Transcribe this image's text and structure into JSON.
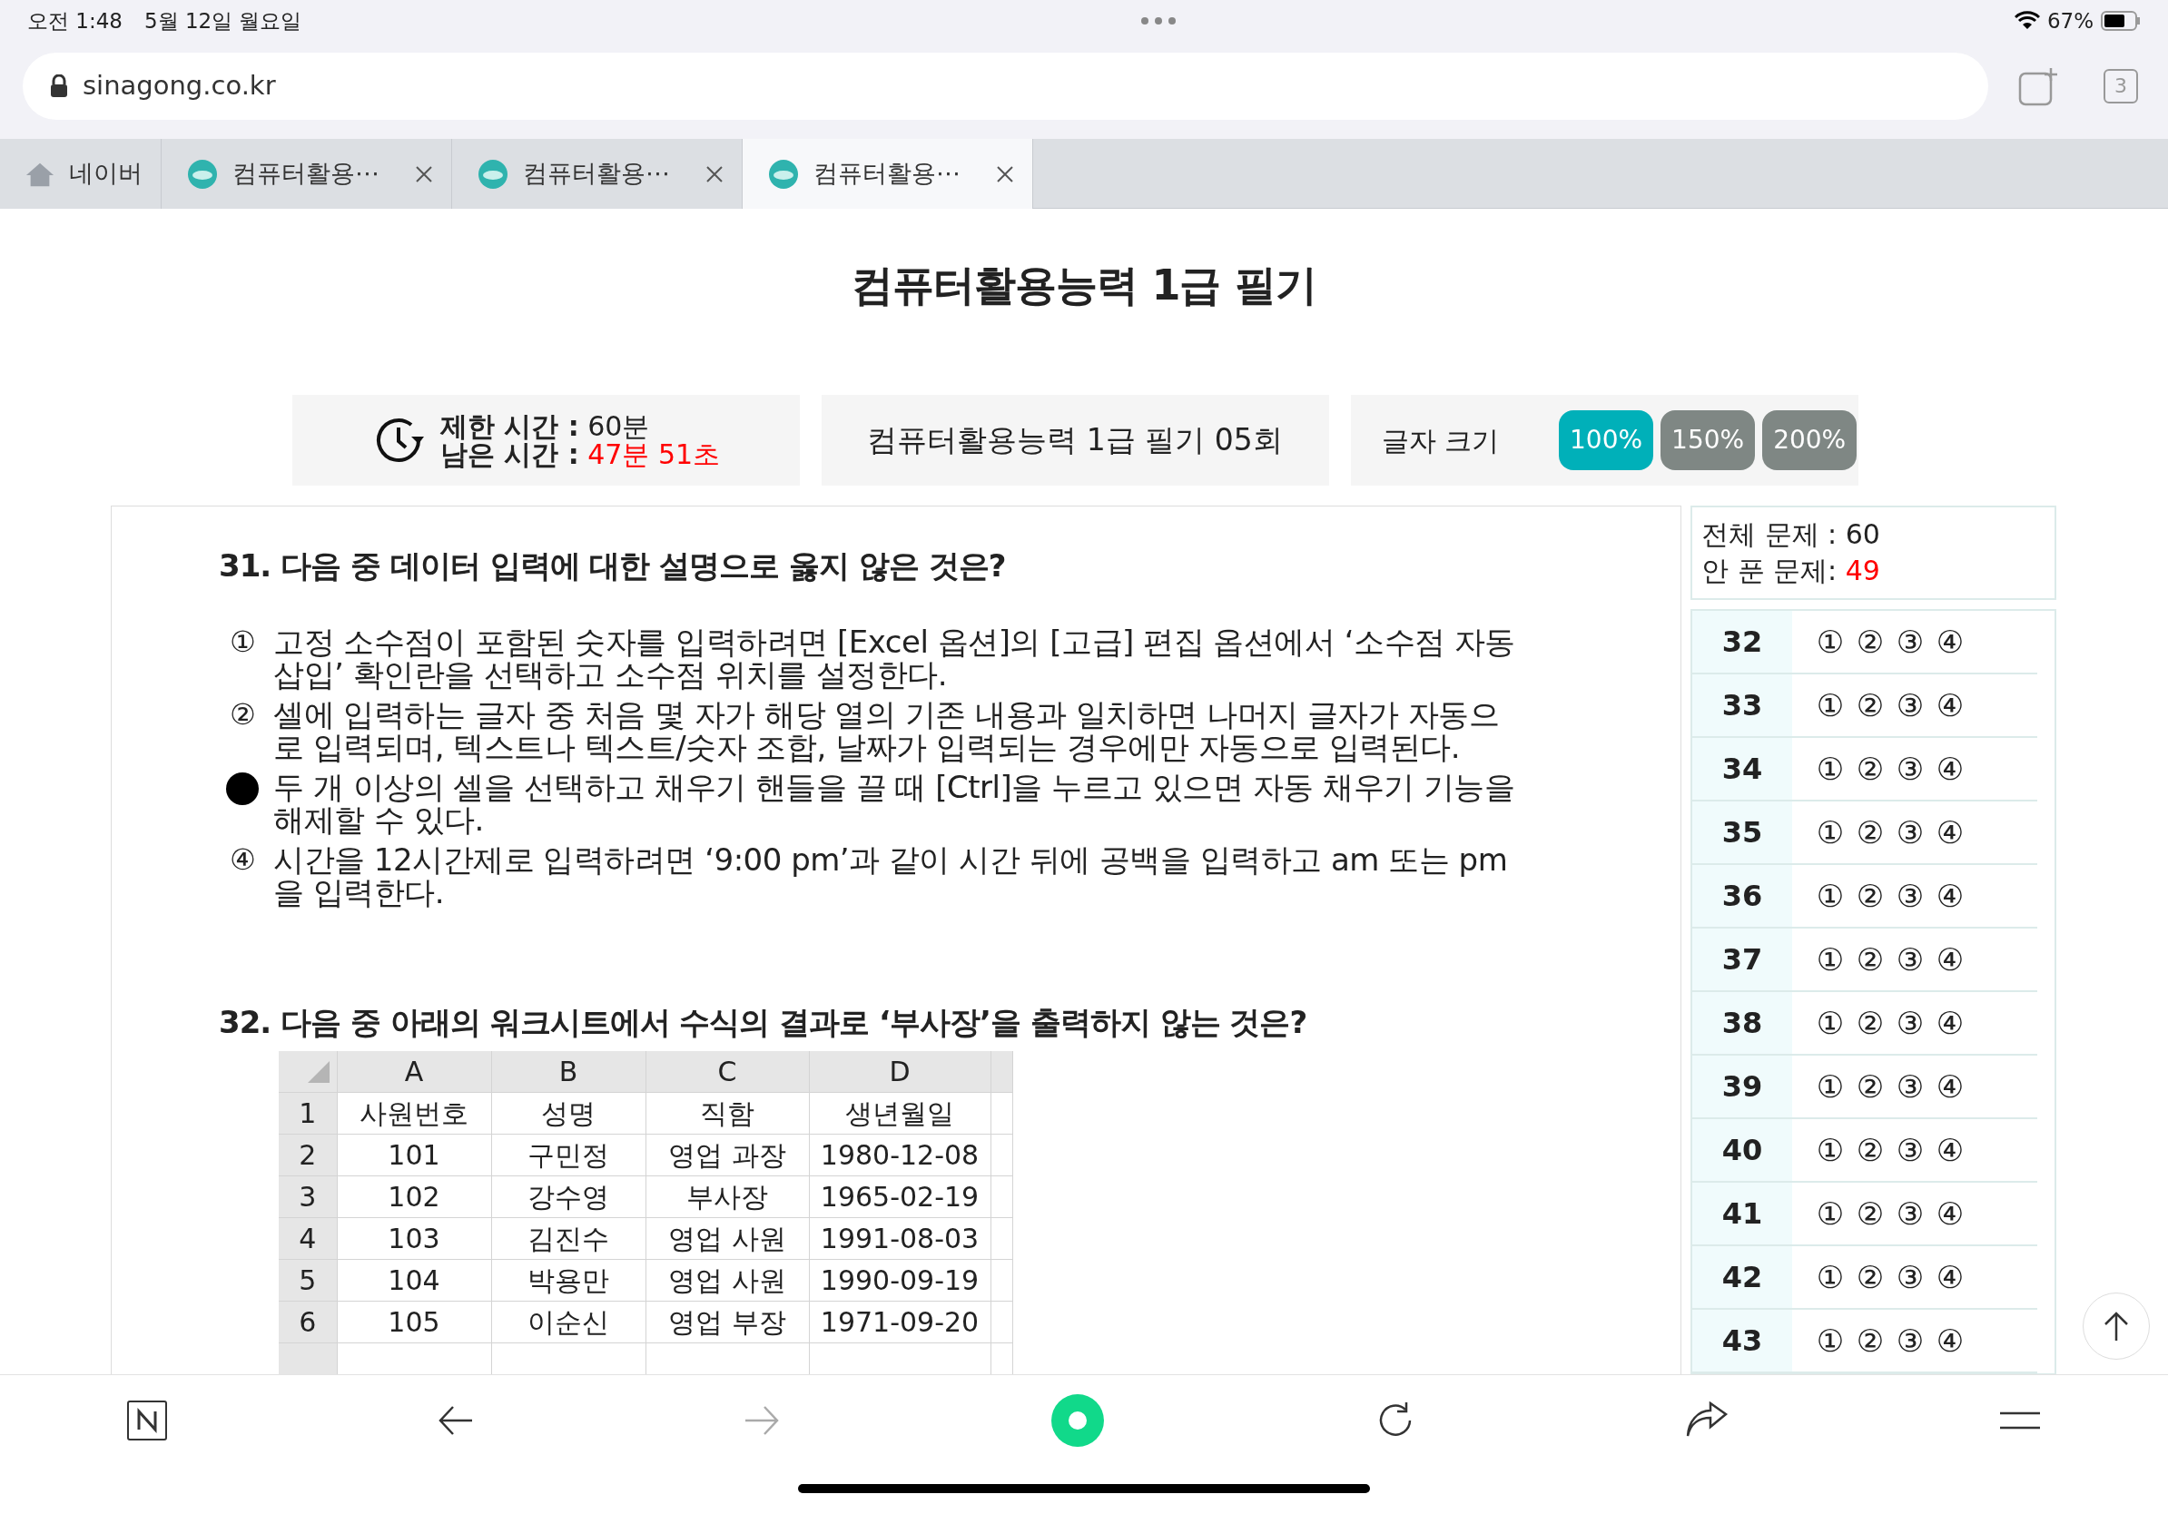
{
  "status_bar": {
    "time": "오전 1:48",
    "date": "5월 12일 월요일",
    "battery": "67%"
  },
  "address_bar": {
    "url": "sinagong.co.kr",
    "tab_count": "3"
  },
  "tabs": [
    {
      "kind": "home",
      "label": "네이버",
      "selected": false
    },
    {
      "kind": "site",
      "label": "컴퓨터활용⋯",
      "selected": false
    },
    {
      "kind": "site",
      "label": "컴퓨터활용⋯",
      "selected": false
    },
    {
      "kind": "site",
      "label": "컴퓨터활용⋯",
      "selected": true
    }
  ],
  "page": {
    "title": "컴퓨터활용능력 1급 필기",
    "timer": {
      "limit_label": "제한 시간 :",
      "limit": "60분",
      "remaining_label": "남은 시간 :",
      "remaining": "47분 51초"
    },
    "exam_name": "컴퓨터활용능력 1급 필기 05회",
    "font_size": {
      "label": "글자 크기",
      "options": [
        {
          "label": "100%",
          "selected": true
        },
        {
          "label": "150%",
          "selected": false
        },
        {
          "label": "200%",
          "selected": false
        }
      ]
    },
    "questions": [
      {
        "number": "31.",
        "text": "다음 중 데이터 입력에 대한 설명으로 옳지 않은 것은?",
        "options": [
          {
            "marker": "①",
            "text": "고정 소수점이 포함된 숫자를 입력하려면 [Excel 옵션]의 [고급] 편집 옵션에서 ‘소수점 자동 삽입’ 확인란을 선택하고 소수점 위치를 설정한다.",
            "selected": false
          },
          {
            "marker": "②",
            "text": "셀에 입력하는 글자 중 처음 몇 자가 해당 열의 기존 내용과 일치하면 나머지 글자가 자동으로 입력되며, 텍스트나 텍스트/숫자 조합, 날짜가 입력되는 경우에만 자동으로 입력된다.",
            "selected": false
          },
          {
            "text": "두 개 이상의 셀을 선택하고 채우기 핸들을 끌 때 [Ctrl]을 누르고 있으면 자동 채우기 기능을 해제할 수 있다.",
            "selected": true
          },
          {
            "marker": "④",
            "text": "시간을 12시간제로 입력하려면 ‘9:00 pm’과 같이 시간 뒤에 공백을 입력하고 am 또는 pm을 입력한다.",
            "selected": false
          }
        ]
      },
      {
        "number": "32.",
        "text": "다음 중 아래의 워크시트에서 수식의 결과로 ‘부사장’을 출력하지 않는 것은?",
        "sheet": {
          "columns": [
            "A",
            "B",
            "C",
            "D"
          ],
          "rows": [
            {
              "row": "1",
              "cells": [
                "사원번호",
                "성명",
                "직함",
                "생년월일"
              ]
            },
            {
              "row": "2",
              "cells": [
                "101",
                "구민정",
                "영업 과장",
                "1980-12-08"
              ]
            },
            {
              "row": "3",
              "cells": [
                "102",
                "강수영",
                "부사장",
                "1965-02-19"
              ]
            },
            {
              "row": "4",
              "cells": [
                "103",
                "김진수",
                "영업 사원",
                "1991-08-03"
              ]
            },
            {
              "row": "5",
              "cells": [
                "104",
                "박용만",
                "영업 사원",
                "1990-09-19"
              ]
            },
            {
              "row": "6",
              "cells": [
                "105",
                "이순신",
                "영업 부장",
                "1971-09-20"
              ]
            }
          ]
        }
      }
    ],
    "summary": {
      "total_label": "전체 문제 :",
      "total": "60",
      "unsolved_label": "안 푼 문제:",
      "unsolved": "49"
    },
    "answer_sheet": [
      {
        "number": "32",
        "choices": [
          {
            "label": "①",
            "selected": false
          },
          {
            "label": "②",
            "selected": false
          },
          {
            "label": "③",
            "selected": false
          },
          {
            "label": "④",
            "selected": false
          }
        ]
      },
      {
        "number": "33",
        "choices": [
          {
            "label": "①",
            "selected": false
          },
          {
            "label": "②",
            "selected": false
          },
          {
            "label": "③",
            "selected": false
          },
          {
            "label": "④",
            "selected": false
          }
        ]
      },
      {
        "number": "34",
        "choices": [
          {
            "label": "①",
            "selected": false
          },
          {
            "label": "②",
            "selected": false
          },
          {
            "label": "③",
            "selected": false
          },
          {
            "label": "④",
            "selected": false
          }
        ]
      },
      {
        "number": "35",
        "choices": [
          {
            "label": "①",
            "selected": false
          },
          {
            "label": "②",
            "selected": false
          },
          {
            "label": "③",
            "selected": false
          },
          {
            "label": "④",
            "selected": false
          }
        ]
      },
      {
        "number": "36",
        "choices": [
          {
            "label": "①",
            "selected": false
          },
          {
            "label": "②",
            "selected": false
          },
          {
            "label": "③",
            "selected": false
          },
          {
            "label": "④",
            "selected": false
          }
        ]
      },
      {
        "number": "37",
        "choices": [
          {
            "label": "①",
            "selected": false
          },
          {
            "label": "②",
            "selected": false
          },
          {
            "label": "③",
            "selected": false
          },
          {
            "label": "④",
            "selected": false
          }
        ]
      },
      {
        "number": "38",
        "choices": [
          {
            "label": "①",
            "selected": false
          },
          {
            "label": "②",
            "selected": false
          },
          {
            "label": "③",
            "selected": false
          },
          {
            "label": "④",
            "selected": false
          }
        ]
      },
      {
        "number": "39",
        "choices": [
          {
            "label": "①",
            "selected": false
          },
          {
            "label": "②",
            "selected": false
          },
          {
            "label": "③",
            "selected": false
          },
          {
            "label": "④",
            "selected": false
          }
        ]
      },
      {
        "number": "40",
        "choices": [
          {
            "label": "①",
            "selected": false
          },
          {
            "label": "②",
            "selected": false
          },
          {
            "label": "③",
            "selected": false
          },
          {
            "label": "④",
            "selected": false
          }
        ]
      },
      {
        "number": "41",
        "choices": [
          {
            "label": "①",
            "selected": false
          },
          {
            "label": "②",
            "selected": false
          },
          {
            "label": "③",
            "selected": false
          },
          {
            "label": "④",
            "selected": false
          }
        ]
      },
      {
        "number": "42",
        "choices": [
          {
            "label": "①",
            "selected": false
          },
          {
            "label": "②",
            "selected": false
          },
          {
            "label": "③",
            "selected": false
          },
          {
            "label": "④",
            "selected": false
          }
        ]
      },
      {
        "number": "43",
        "choices": [
          {
            "label": "①",
            "selected": false
          },
          {
            "label": "②",
            "selected": false
          },
          {
            "label": "③",
            "selected": false
          },
          {
            "label": "④",
            "selected": false
          }
        ]
      }
    ]
  }
}
